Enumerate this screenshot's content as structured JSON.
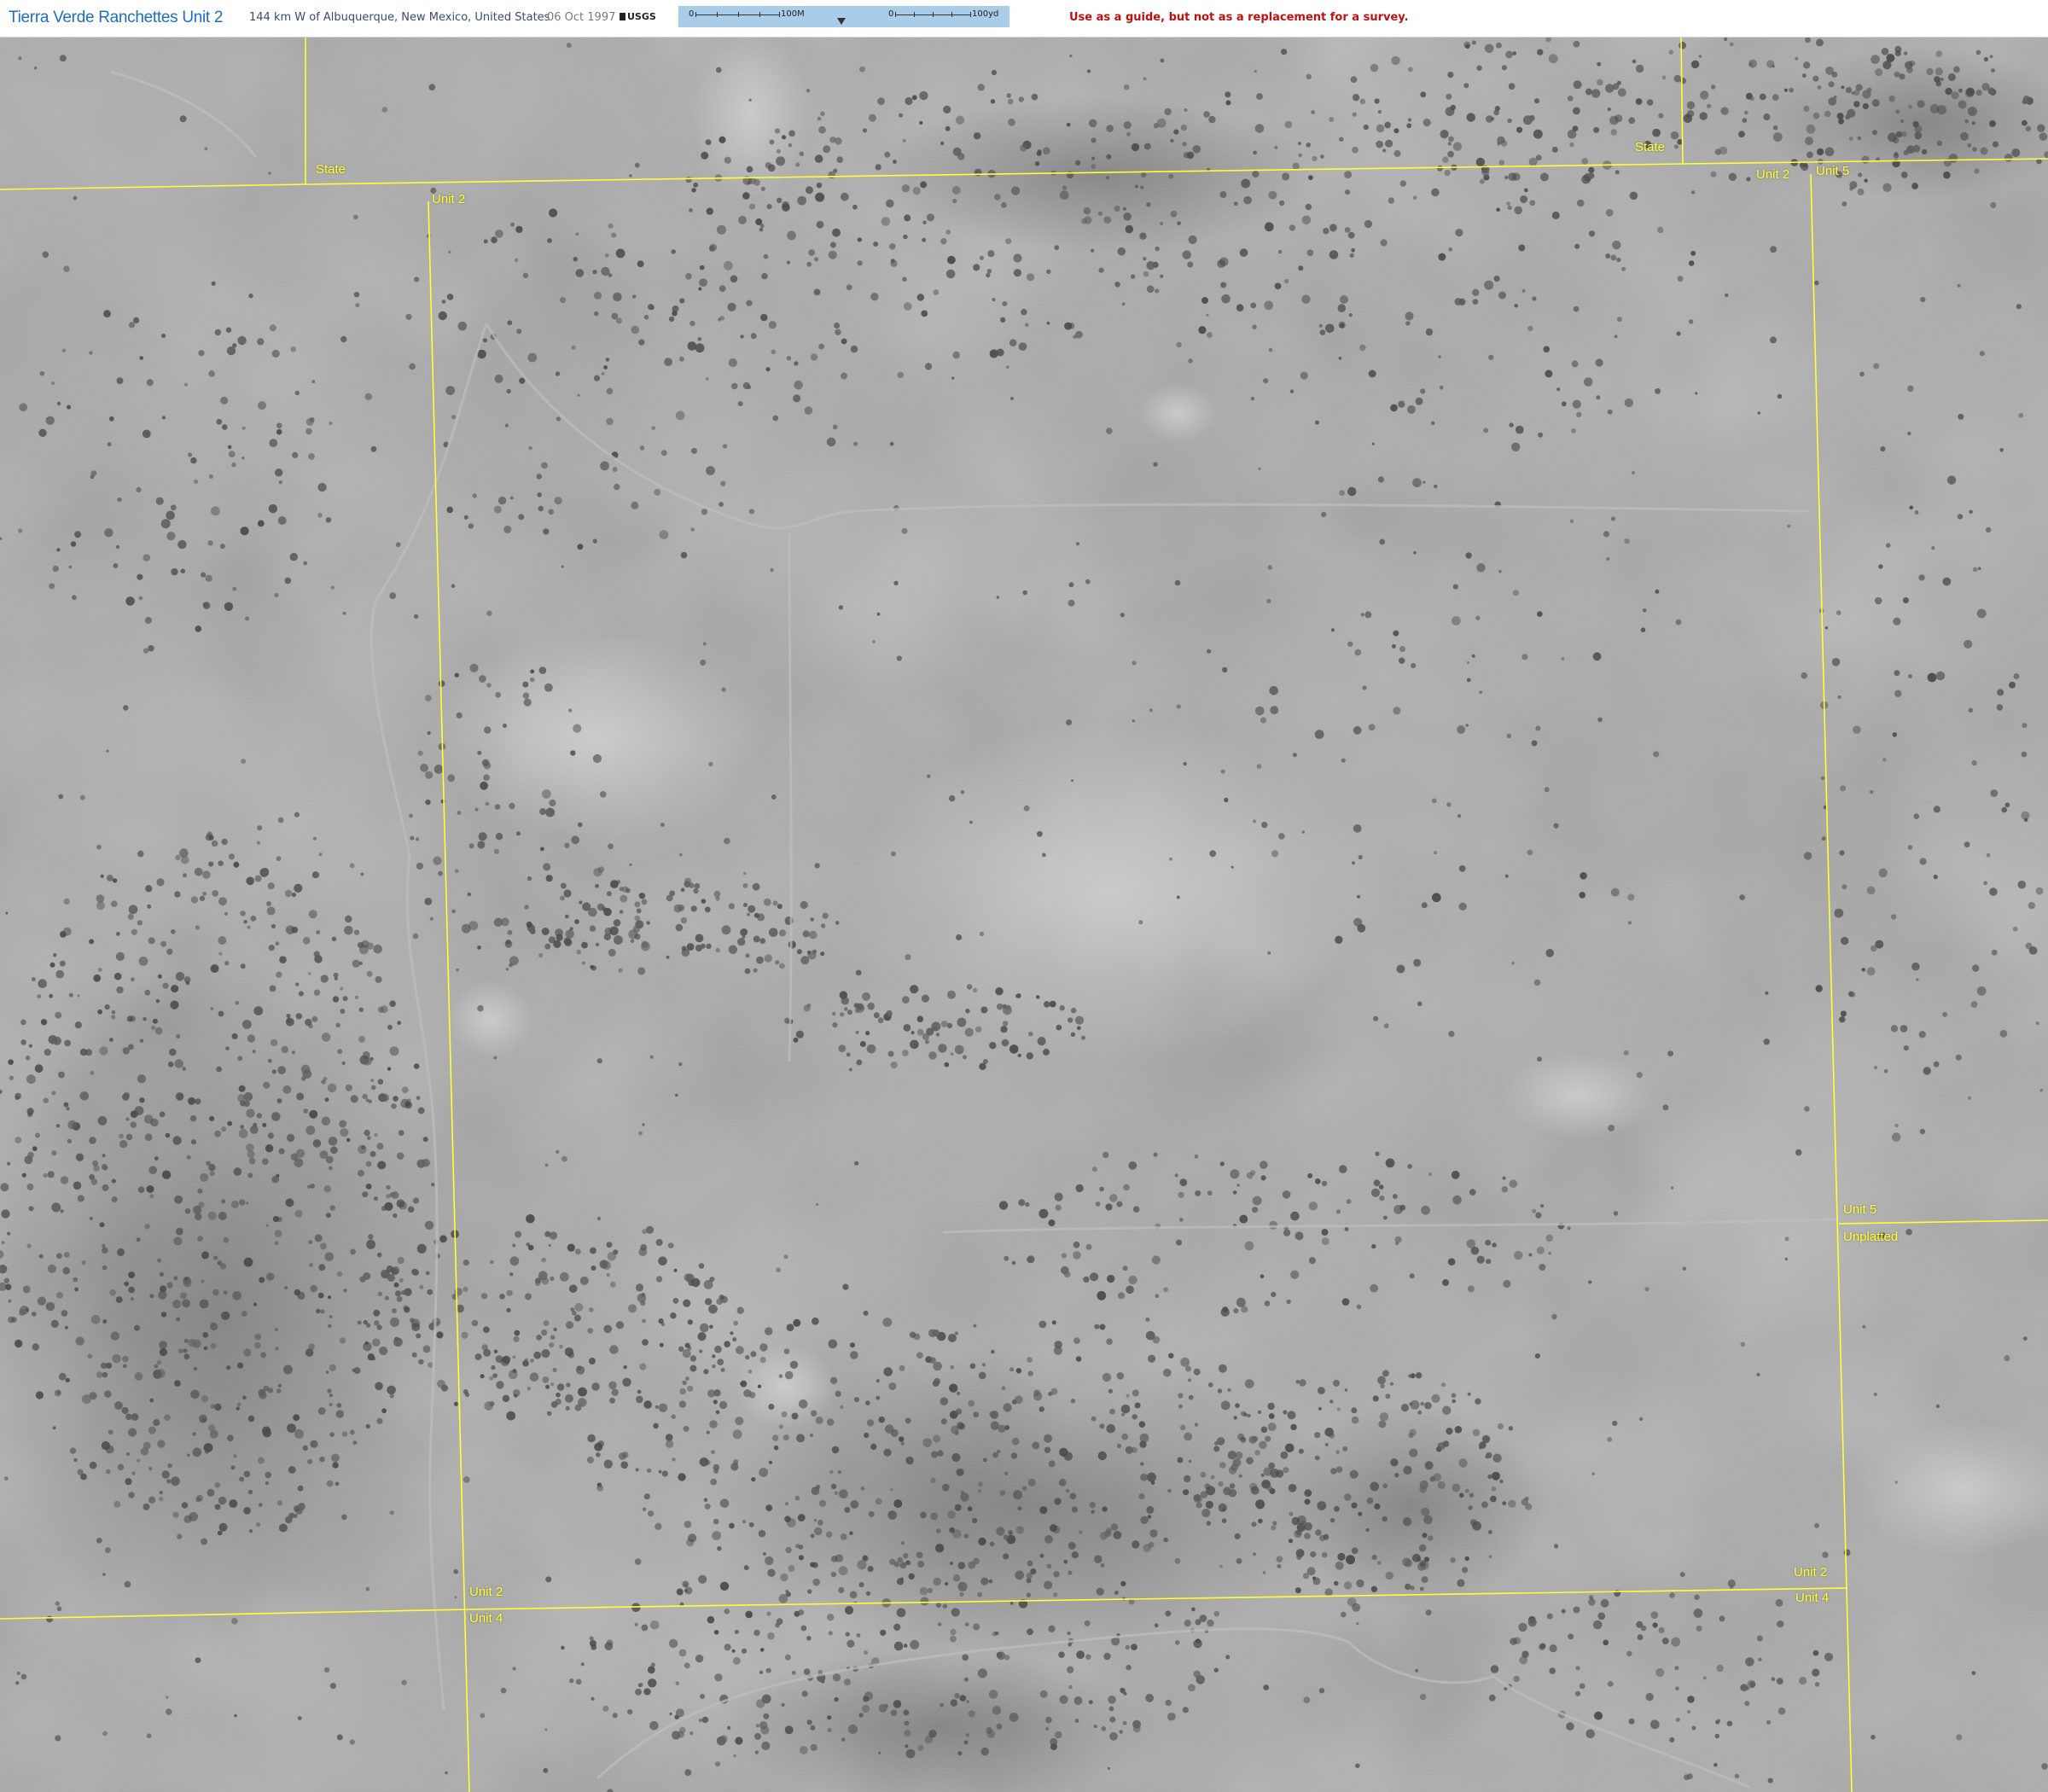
{
  "header": {
    "title": "Tierra Verde Ranchettes Unit 2",
    "location": "144 km W of Albuquerque, New Mexico, United States",
    "date": "06 Oct 1997",
    "source": "USGS",
    "disclaimer": "Use as a guide, but not as a replacement for a survey."
  },
  "scale": {
    "metric_start": "0",
    "metric_end": "100M",
    "imperial_start": "0",
    "imperial_end": "100yd"
  },
  "map": {
    "imagery": "aerial grayscale",
    "parcel_labels": [
      {
        "id": "state-top-left",
        "text": "State"
      },
      {
        "id": "state-top-right",
        "text": "State"
      },
      {
        "id": "unit2-top-left",
        "text": "Unit 2"
      },
      {
        "id": "unit2-top-right",
        "text": "Unit 2"
      },
      {
        "id": "unit5-top-right",
        "text": "Unit 5"
      },
      {
        "id": "unit5-mid-right",
        "text": "Unit 5"
      },
      {
        "id": "unplatted-mid-right",
        "text": "Unplatted"
      },
      {
        "id": "unit2-bottom-left",
        "text": "Unit 2"
      },
      {
        "id": "unit4-bottom-left",
        "text": "Unit 4"
      },
      {
        "id": "unit2-bottom-right",
        "text": "Unit 2"
      },
      {
        "id": "unit4-bottom-right",
        "text": "Unit 4"
      }
    ]
  },
  "colors": {
    "title": "#1f6fc0",
    "disclaimer": "#c01010",
    "parcel_line": "#ffff33",
    "scale_bar_bg": "#a9cde9"
  }
}
